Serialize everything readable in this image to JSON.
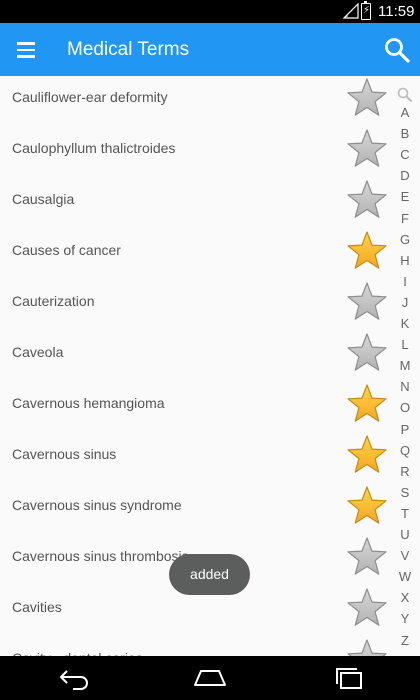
{
  "status_bar": {
    "time": "11:59"
  },
  "app_bar": {
    "title": "Medical Terms"
  },
  "terms": [
    {
      "label": "Cauliflower-ear deformity",
      "favorite": false
    },
    {
      "label": "Caulophyllum thalictroides",
      "favorite": false
    },
    {
      "label": "Causalgia",
      "favorite": false
    },
    {
      "label": "Causes of cancer",
      "favorite": true
    },
    {
      "label": "Cauterization",
      "favorite": false
    },
    {
      "label": "Caveola",
      "favorite": false
    },
    {
      "label": "Cavernous hemangioma",
      "favorite": true
    },
    {
      "label": "Cavernous sinus",
      "favorite": true
    },
    {
      "label": "Cavernous sinus syndrome",
      "favorite": true
    },
    {
      "label": "Cavernous sinus thrombosis",
      "favorite": false
    },
    {
      "label": "Cavities",
      "favorite": false
    },
    {
      "label": "Cavity - dental caries",
      "favorite": false
    }
  ],
  "index_letters": [
    "A",
    "B",
    "C",
    "D",
    "E",
    "F",
    "G",
    "H",
    "I",
    "J",
    "K",
    "L",
    "M",
    "N",
    "O",
    "P",
    "Q",
    "R",
    "S",
    "T",
    "U",
    "V",
    "W",
    "X",
    "Y",
    "Z"
  ],
  "toast": {
    "message": "added"
  },
  "colors": {
    "app_bar": "#2196f3",
    "star_on": "#f5a623",
    "star_off": "#b3b3b3"
  }
}
